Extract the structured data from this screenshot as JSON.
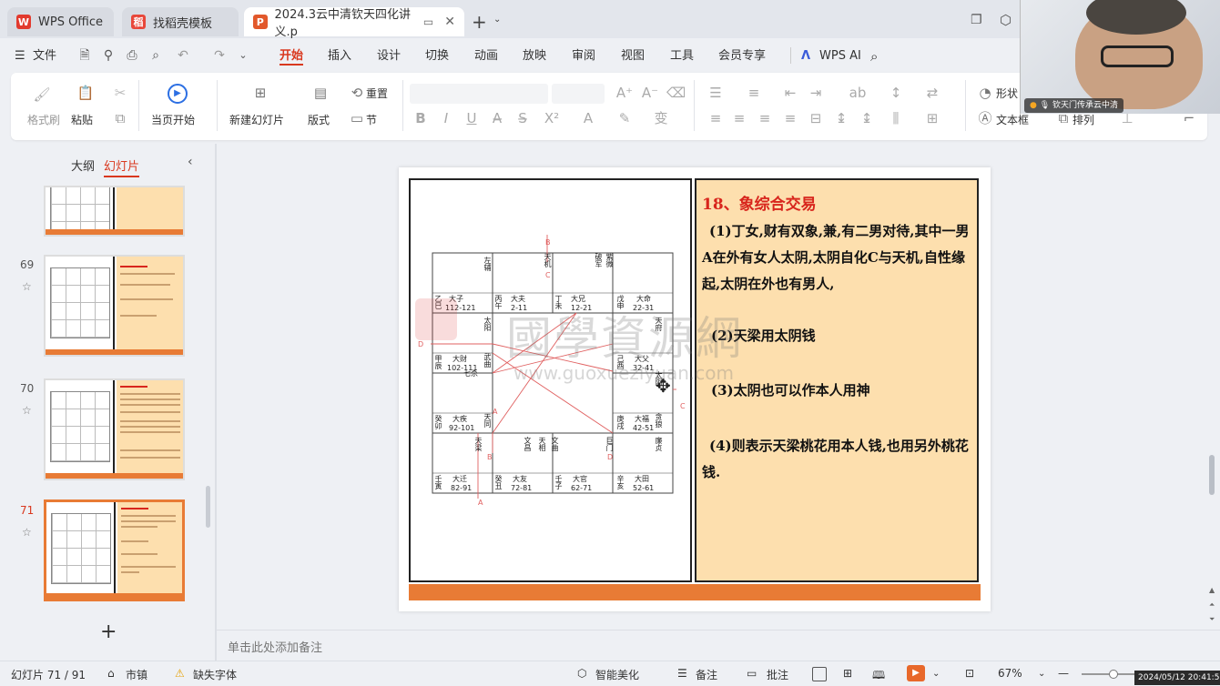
{
  "tabs": {
    "wps": "WPS Office",
    "template": "找稻壳模板",
    "doc": "2024.3云中清钦天四化讲义.p"
  },
  "menu": {
    "file": "文件",
    "items": [
      "开始",
      "插入",
      "设计",
      "切换",
      "动画",
      "放映",
      "审阅",
      "视图",
      "工具",
      "会员专享"
    ],
    "wps_ai": "WPS AI"
  },
  "ribbon": {
    "format_painter": "格式刷",
    "paste": "粘贴",
    "from_current": "当页开始",
    "new_slide": "新建幻灯片",
    "layout": "版式",
    "reset": "重置",
    "section": "节",
    "shape": "形状",
    "textbox": "文本框",
    "arrange": "排列"
  },
  "sidebar": {
    "outline": "大纲",
    "slides": "幻灯片",
    "numbers": [
      "69",
      "70",
      "71"
    ],
    "add": "+"
  },
  "video": {
    "name": "钦天门传承云中清"
  },
  "slide": {
    "title": "18、象综合交易",
    "p1": "(1)丁女,财有双象,兼,有二男对待,其中一男A在外有女人太阴,太阴自化C与天机,自性缘起,太阴在外也有男人,",
    "p2": "(2)天梁用太阴钱",
    "p3": "(3)太阴也可以作本人用神",
    "p4": "(4)则表示天梁桃花用本人钱,也用另外桃花钱.",
    "watermark_cn": "國學資源網",
    "watermark_url": "www.guoxueziyuan.com"
  },
  "chart": {
    "labels_top": [
      "左辅",
      "天机",
      "破军",
      "紫微"
    ],
    "row1": [
      [
        "乙巳",
        "大子",
        "112-121"
      ],
      [
        "丙午",
        "大夫",
        "2-11"
      ],
      [
        "丁未",
        "大兄",
        "12-21"
      ],
      [
        "戊申",
        "大命",
        "22-31"
      ]
    ],
    "row1_stars": [
      "太阳",
      "天府"
    ],
    "row2": [
      [
        "甲辰",
        "大财",
        "102-111"
      ],
      [
        "己酉",
        "大父",
        "32-41"
      ]
    ],
    "row2_stars": [
      "武曲",
      "七杀",
      "太阴"
    ],
    "row3": [
      [
        "癸卯",
        "大疾",
        "92-101"
      ],
      [
        "庚戌",
        "大福",
        "42-51"
      ]
    ],
    "row3_stars": [
      "天同",
      "贪狼"
    ],
    "row4_stars": [
      "天梁",
      "文昌",
      "天相",
      "巨门",
      "文曲",
      "廉贞"
    ],
    "row4": [
      [
        "壬寅",
        "大迁",
        "82-91"
      ],
      [
        "癸丑",
        "大友",
        "72-81"
      ],
      [
        "壬子",
        "大官",
        "62-71"
      ],
      [
        "辛亥",
        "大田",
        "52-61"
      ]
    ],
    "marks": [
      "B",
      "C",
      "D",
      "A",
      "C",
      "D",
      "B",
      "A"
    ]
  },
  "notes": {
    "placeholder": "单击此处添加备注"
  },
  "status": {
    "slide_count": "幻灯片 71 / 91",
    "town": "市镇",
    "missing_font": "缺失字体",
    "beautify": "智能美化",
    "notes": "备注",
    "comment": "批注",
    "zoom": "67%",
    "datetime": "2024/05/12 20:41:56"
  },
  "colors": {
    "accent": "#d9381e",
    "slide_orange": "#e87b35",
    "slide_panel": "#fddfae",
    "title_red": "#d8261d"
  }
}
